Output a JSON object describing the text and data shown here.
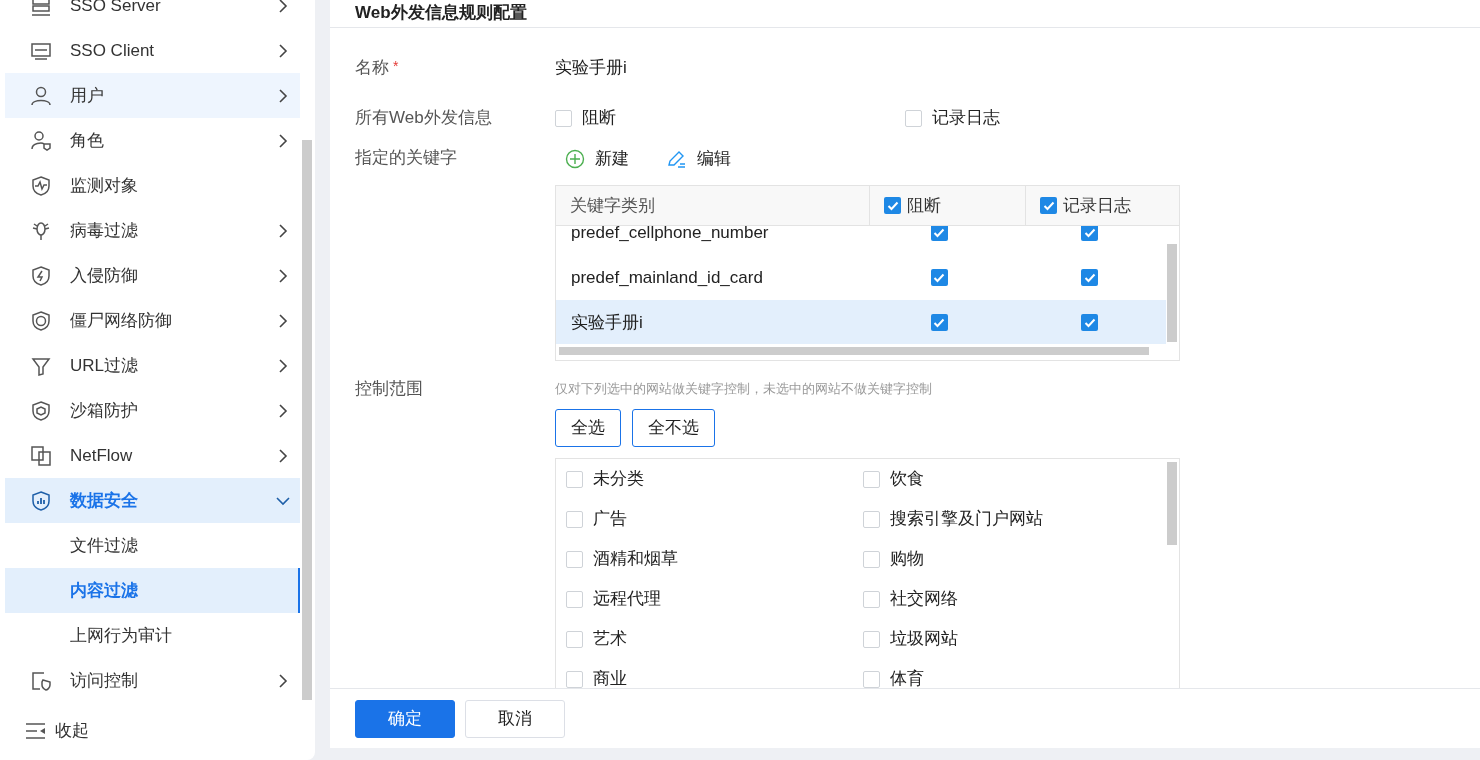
{
  "sidebar": {
    "items": [
      {
        "label": "SSO Server",
        "has_submenu": true,
        "hovered": false,
        "expanded": false
      },
      {
        "label": "SSO Client",
        "has_submenu": true,
        "hovered": false,
        "expanded": false
      },
      {
        "label": "用户",
        "has_submenu": true,
        "hovered": true,
        "expanded": false
      },
      {
        "label": "角色",
        "has_submenu": true,
        "hovered": false,
        "expanded": false
      },
      {
        "label": "监测对象",
        "has_submenu": false,
        "hovered": false,
        "expanded": false
      },
      {
        "label": "病毒过滤",
        "has_submenu": true,
        "hovered": false,
        "expanded": false
      },
      {
        "label": "入侵防御",
        "has_submenu": true,
        "hovered": false,
        "expanded": false
      },
      {
        "label": "僵尸网络防御",
        "has_submenu": true,
        "hovered": false,
        "expanded": false
      },
      {
        "label": "URL过滤",
        "has_submenu": true,
        "hovered": false,
        "expanded": false
      },
      {
        "label": "沙箱防护",
        "has_submenu": true,
        "hovered": false,
        "expanded": false
      },
      {
        "label": "NetFlow",
        "has_submenu": true,
        "hovered": false,
        "expanded": false
      },
      {
        "label": "数据安全",
        "has_submenu": true,
        "hovered": false,
        "expanded": true,
        "children": [
          {
            "label": "文件过滤",
            "selected": false
          },
          {
            "label": "内容过滤",
            "selected": true
          },
          {
            "label": "上网行为审计",
            "selected": false
          }
        ]
      },
      {
        "label": "访问控制",
        "has_submenu": true,
        "hovered": false,
        "expanded": false
      }
    ],
    "collapse": "收起"
  },
  "dialog": {
    "title": "Web外发信息规则配置",
    "name_field": {
      "label": "名称",
      "required": true,
      "required_mark": "*",
      "value": "实验手册i"
    },
    "all_web": {
      "label": "所有Web外发信息",
      "options": [
        {
          "label": "阻断",
          "checked": false
        },
        {
          "label": "记录日志",
          "checked": false
        }
      ]
    },
    "keywords": {
      "label": "指定的关键字",
      "actions": [
        {
          "kind": "add",
          "label": "新建"
        },
        {
          "kind": "edit",
          "label": "编辑"
        }
      ],
      "table": {
        "columns": [
          {
            "label": "关键字类别",
            "kind": "text"
          },
          {
            "label": "阻断",
            "kind": "checkbox",
            "checked": true
          },
          {
            "label": "记录日志",
            "kind": "checkbox",
            "checked": true
          }
        ],
        "rows": [
          {
            "name": "predef_cellphone_number",
            "block": true,
            "log": true,
            "selected": false
          },
          {
            "name": "predef_mainland_id_card",
            "block": true,
            "log": true,
            "selected": false
          },
          {
            "name": "实验手册i",
            "block": true,
            "log": true,
            "selected": true
          }
        ]
      }
    },
    "scope": {
      "label": "控制范围",
      "hint": "仅对下列选中的网站做关键字控制，未选中的网站不做关键字控制",
      "buttons": [
        "全选",
        "全不选"
      ],
      "sites": [
        {
          "label": "未分类",
          "checked": false
        },
        {
          "label": "饮食",
          "checked": false
        },
        {
          "label": "广告",
          "checked": false
        },
        {
          "label": "搜索引擎及门户网站",
          "checked": false
        },
        {
          "label": "酒精和烟草",
          "checked": false
        },
        {
          "label": "购物",
          "checked": false
        },
        {
          "label": "远程代理",
          "checked": false
        },
        {
          "label": "社交网络",
          "checked": false
        },
        {
          "label": "艺术",
          "checked": false
        },
        {
          "label": "垃圾网站",
          "checked": false
        },
        {
          "label": "商业",
          "checked": false
        },
        {
          "label": "体育",
          "checked": false
        }
      ]
    },
    "footer": [
      {
        "kind": "primary",
        "label": "确定"
      },
      {
        "kind": "secondary",
        "label": "取消"
      }
    ]
  }
}
